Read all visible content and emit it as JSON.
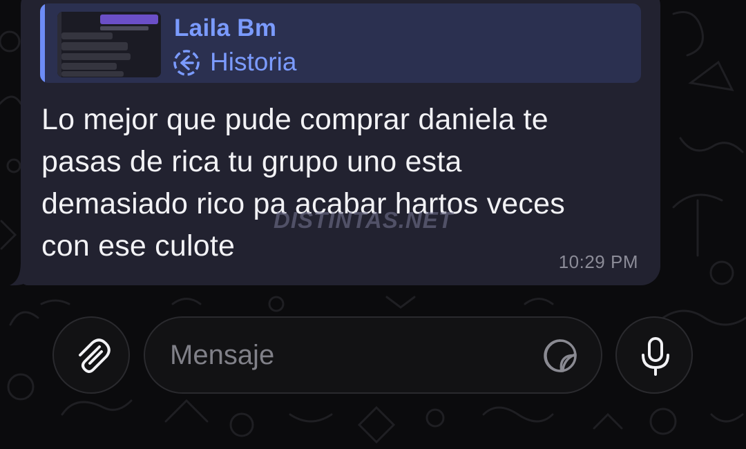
{
  "message": {
    "reply": {
      "sender_name": "Laila Bm",
      "context_label": "Historia"
    },
    "text": "Lo mejor que pude comprar daniela te\npasas de rica tu grupo uno esta\ndemasiado rico pa acabar hartos veces\ncon ese culote",
    "time": "10:29 PM",
    "watermark": "DISTINTAS.NET"
  },
  "composer": {
    "placeholder": "Mensaje",
    "attach_icon": "paperclip-icon",
    "sticker_icon": "sticker-icon",
    "mic_icon": "microphone-icon"
  },
  "colors": {
    "background": "#0b0b0d",
    "bubble": "#222230",
    "reply_box": "#2b3050",
    "accent": "#7b9bff",
    "text": "#f2f2f5",
    "time": "#8c8c98"
  }
}
